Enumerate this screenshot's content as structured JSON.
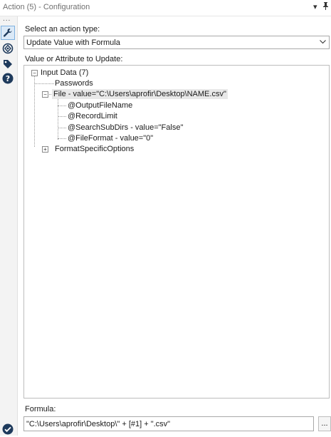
{
  "window": {
    "title": "Action (5) - Configuration",
    "pin_symbol": "▾",
    "pushpin_symbol": "⊥"
  },
  "rail": {
    "dots": "...",
    "icons": [
      "wrench-icon",
      "network-icon",
      "tag-icon",
      "help-icon"
    ],
    "status_icon": "checkmark-icon"
  },
  "action_type": {
    "label": "Select an action type:",
    "selected": "Update Value with Formula"
  },
  "tree": {
    "label": "Value or Attribute to Update:",
    "nodes": [
      {
        "text": "Input Data (7)",
        "toggle": "−"
      },
      {
        "text": "Passwords"
      },
      {
        "text": "File - value=\"C:\\Users\\aprofir\\Desktop\\NAME.csv\"",
        "toggle": "−"
      },
      {
        "text": "@OutputFileName"
      },
      {
        "text": "@RecordLimit"
      },
      {
        "text": "@SearchSubDirs - value=\"False\""
      },
      {
        "text": "@FileFormat - value=\"0\""
      },
      {
        "text": "FormatSpecificOptions",
        "toggle": "+"
      }
    ]
  },
  "formula": {
    "label": "Formula:",
    "value": "\"C:\\Users\\aprofir\\Desktop\\\" + [#1] + \".csv\"",
    "button": "..."
  },
  "colors": {
    "accent": "#2b6cb0",
    "selected_bg": "#dbe9f7",
    "text": "#1b1b1b"
  }
}
